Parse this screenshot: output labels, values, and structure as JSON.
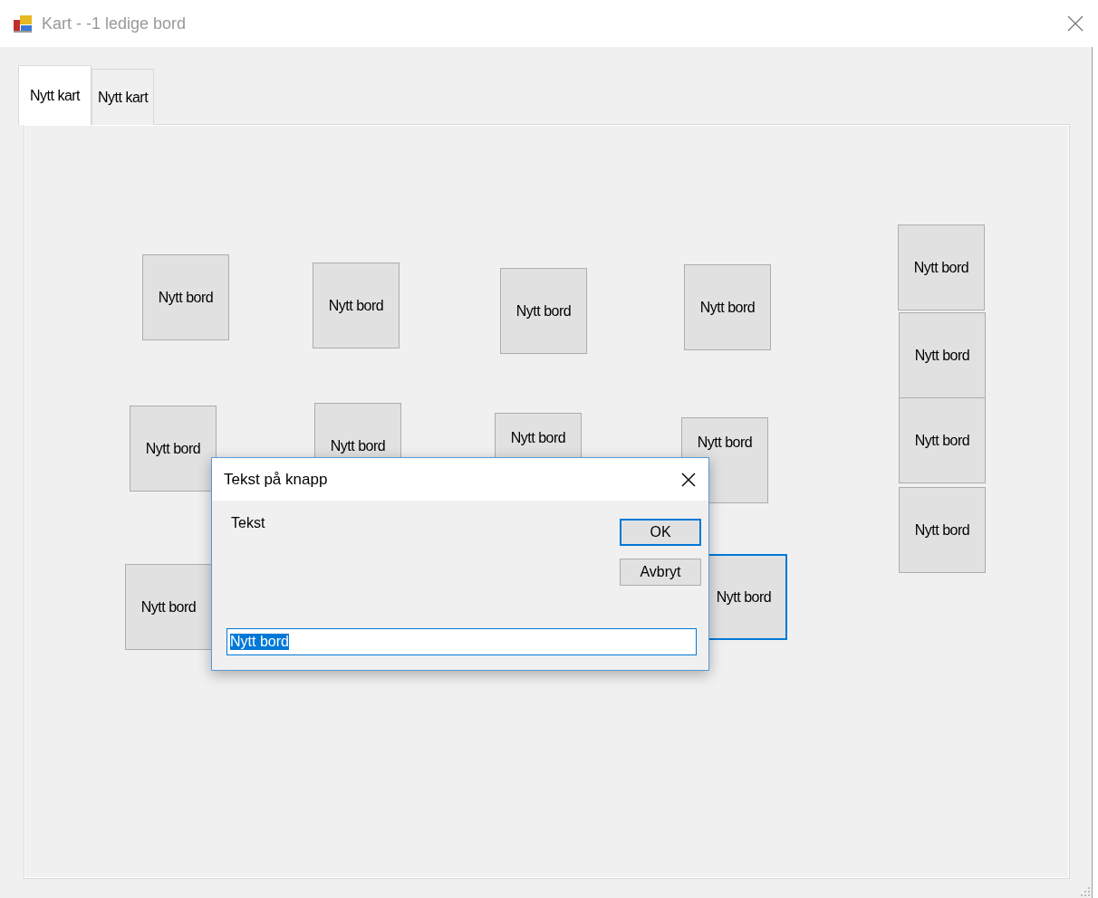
{
  "window": {
    "title": "Kart - -1 ledige bord"
  },
  "tabs": [
    {
      "label": "Nytt kart",
      "selected": true
    },
    {
      "label": "Nytt kart",
      "selected": false
    }
  ],
  "tables": [
    {
      "label": "Nytt bord",
      "selected": false
    },
    {
      "label": "Nytt bord",
      "selected": false
    },
    {
      "label": "Nytt bord",
      "selected": false
    },
    {
      "label": "Nytt bord",
      "selected": false
    },
    {
      "label": "Nytt bord",
      "selected": false
    },
    {
      "label": "Nytt bord",
      "selected": false
    },
    {
      "label": "Nytt bord",
      "selected": false
    },
    {
      "label": "Nytt bord",
      "selected": false
    },
    {
      "label": "Nytt bord",
      "selected": false
    },
    {
      "label": "Nytt bord",
      "selected": false
    },
    {
      "label": "Nytt bord",
      "selected": false
    },
    {
      "label": "Nytt bord",
      "selected": false
    },
    {
      "label": "Nytt bord",
      "selected": false
    },
    {
      "label": "Nytt bord",
      "selected": true
    }
  ],
  "dialog": {
    "title": "Tekst på knapp",
    "prompt": "Tekst",
    "buttons": [
      {
        "label": "OK",
        "default": true
      },
      {
        "label": "Avbryt",
        "default": false
      }
    ],
    "field": {
      "value": "Nytt bord",
      "text_selected": true
    }
  }
}
